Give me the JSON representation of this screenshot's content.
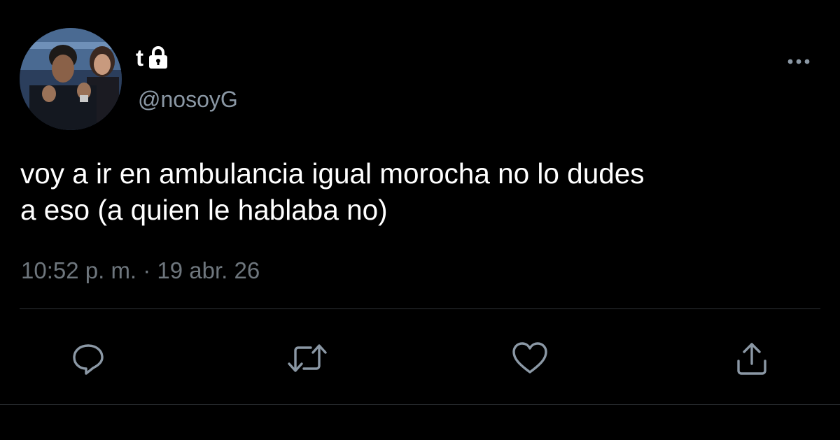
{
  "tweet": {
    "display_name": "t",
    "handle": "@nosoyG",
    "text": "voy a ir en ambulancia igual morocha no lo dudes\na eso (a quien le hablaba no)",
    "timestamp": "10:52 p. m. · 19 abr. 26",
    "protected": true
  },
  "icons": {
    "lock": "lock-icon",
    "more": "more-options-icon",
    "reply": "reply-icon",
    "retweet": "retweet-icon",
    "like": "heart-icon",
    "share": "share-icon"
  },
  "colors": {
    "background": "#000000",
    "text": "#ffffff",
    "secondary_text": "#8b98a5",
    "icon": "#8b98a5",
    "divider": "#2f3336"
  }
}
